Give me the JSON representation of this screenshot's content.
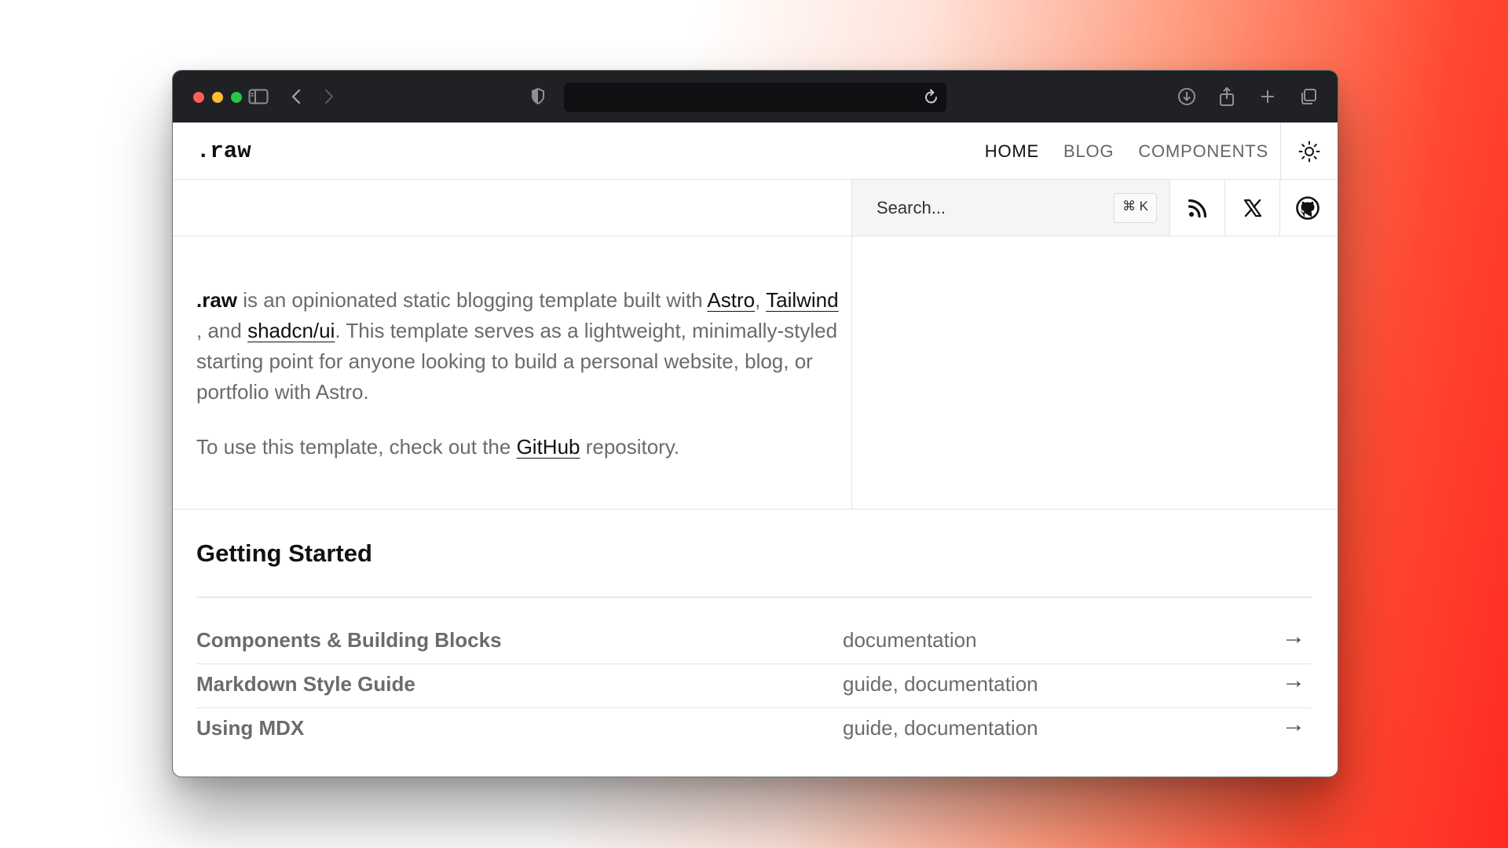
{
  "site": {
    "logo": ".raw",
    "nav": [
      {
        "label": "HOME",
        "active": true
      },
      {
        "label": "BLOG",
        "active": false
      },
      {
        "label": "COMPONENTS",
        "active": false
      }
    ]
  },
  "search": {
    "placeholder": "Search...",
    "shortcut": "⌘ K"
  },
  "intro": {
    "brand": ".raw",
    "text1": " is an opinionated static blogging template built with ",
    "link_astro": "Astro",
    "comma": ",",
    "link_tailwind": "Tailwind",
    "and": " , and ",
    "link_shadcn": "shadcn/ui",
    "text2": ". This template serves as a lightweight, minimally-styled starting point for anyone looking to build a personal website, blog, or portfolio with Astro.",
    "p2_before": "To use this template, check out the ",
    "link_github": "GitHub",
    "p2_after": " repository."
  },
  "getting_started": {
    "title": "Getting Started",
    "items": [
      {
        "title": "Components & Building Blocks",
        "tags": "documentation",
        "arrow": "→"
      },
      {
        "title": "Markdown Style Guide",
        "tags": "guide, documentation",
        "arrow": "→"
      },
      {
        "title": "Using MDX",
        "tags": "guide, documentation",
        "arrow": "→"
      }
    ]
  },
  "colors": {
    "chrome_bg": "#1f2124",
    "accent_gradient_end": "#ff2a22"
  }
}
